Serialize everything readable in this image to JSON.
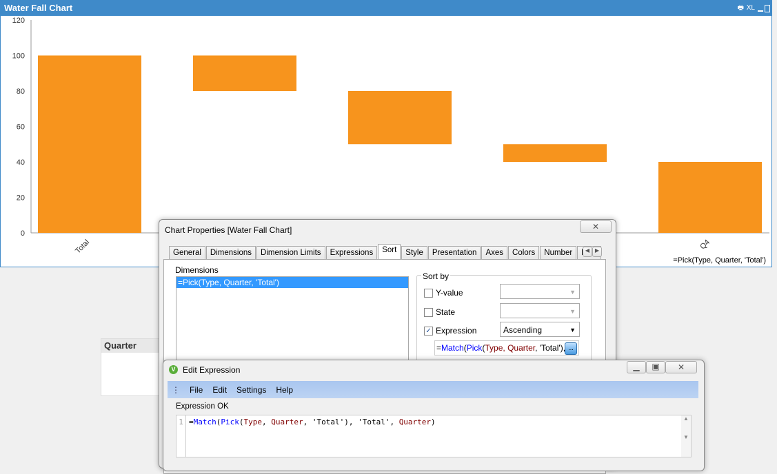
{
  "chart_window": {
    "title": "Water Fall Chart",
    "controls": [
      "print-icon",
      "XL",
      "minimize-icon",
      "maximize-icon"
    ],
    "xl_label": "XL",
    "dimension_label": "=Pick(Type, Quarter, 'Total')"
  },
  "chart_data": {
    "type": "bar",
    "subtype": "waterfall",
    "title": "Water Fall Chart",
    "categories": [
      "Total",
      "",
      "",
      "",
      "Q4"
    ],
    "series": [
      {
        "bottoms": [
          0,
          80,
          50,
          40,
          0
        ],
        "tops": [
          100,
          100,
          80,
          50,
          40
        ]
      }
    ],
    "yticks": [
      0,
      20,
      40,
      60,
      80,
      100,
      120
    ],
    "ylim": [
      0,
      120
    ],
    "xlabel": "=Pick(Type, Quarter, 'Total')",
    "ylabel": "",
    "grid": false,
    "color": "#f7941d"
  },
  "listbox": {
    "title": "Quarter"
  },
  "chart_properties": {
    "title": "Chart Properties [Water Fall Chart]",
    "tabs": [
      "General",
      "Dimensions",
      "Dimension Limits",
      "Expressions",
      "Sort",
      "Style",
      "Presentation",
      "Axes",
      "Colors",
      "Number",
      "Font"
    ],
    "active_tab": "Sort",
    "dimensions_label": "Dimensions",
    "dimensions": [
      "=Pick(Type, Quarter, 'Total')"
    ],
    "sort_by_label": "Sort by",
    "options": [
      {
        "label": "Y-value",
        "checked": false,
        "value": ""
      },
      {
        "label": "State",
        "checked": false,
        "value": ""
      },
      {
        "label": "Expression",
        "checked": true,
        "value": "Ascending"
      }
    ],
    "expression_prefix": "=",
    "expression_fn1": "Match",
    "expression_fn2": "Pick",
    "expression_rest_a": "Type, ",
    "expression_rest_b": "Quarter",
    "expression_rest_c": ", 'Total'),",
    "ellipsis": "..."
  },
  "edit_expression": {
    "title": "Edit Expression",
    "menu": [
      "File",
      "Edit",
      "Settings",
      "Help"
    ],
    "status": "Expression OK",
    "line_number": "1",
    "code": {
      "p0": "=",
      "fn1": "Match",
      "p1": "(",
      "fn2": "Pick",
      "p2": "(",
      "f1": "Type",
      "p3": ", ",
      "f2": "Quarter",
      "p4": ", 'Total'), 'Total', ",
      "f3": "Quarter",
      "p5": ")"
    }
  }
}
